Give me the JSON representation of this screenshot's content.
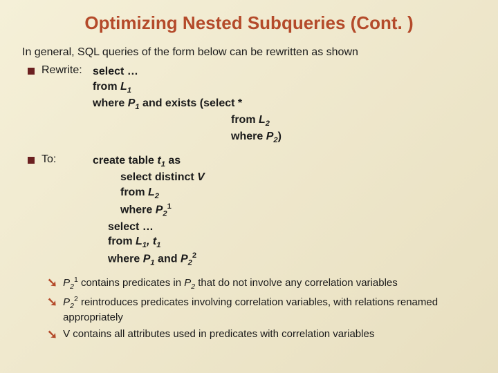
{
  "title": "Optimizing Nested Subqueries (Cont. )",
  "lead": "In general, SQL queries of the form below can be rewritten as shown",
  "rewrite_label": "Rewrite:",
  "to_label": "To:",
  "rewrite": {
    "l1": "select …",
    "l2a": "from ",
    "l2b": "L",
    "l2sub": "1",
    "l3a": "where ",
    "l3b": "P",
    "l3sub": "1",
    "l3c": " and exists (select *",
    "l4a": "from ",
    "l4b": "L",
    "l4sub": "2",
    "l5a": "where ",
    "l5b": "P",
    "l5sub": "2",
    "l5c": ")"
  },
  "to": {
    "l1a": "create table ",
    "l1b": "t",
    "l1sub": "1",
    "l1c": " as",
    "l2a": "select distinct ",
    "l2b": "V",
    "l3a": "from ",
    "l3b": "L",
    "l3sub": "2",
    "l4a": "where ",
    "l4b": "P",
    "l4sub": "2",
    "l4sup": "1",
    "l5": "select …",
    "l6a": "from ",
    "l6b": "L",
    "l6sub": "1",
    "l6c": ", ",
    "l6d": "t",
    "l6sub2": "1",
    "l7a": "where ",
    "l7b": "P",
    "l7sub": "1",
    "l7c": " and ",
    "l7d": "P",
    "l7sub2": "2",
    "l7sup": "2"
  },
  "notes": {
    "n1a": "P",
    "n1sub": "2",
    "n1sup": "1",
    "n1b": " contains predicates in ",
    "n1c": "P",
    "n1sub2": "2",
    "n1d": " that do not involve any correlation variables",
    "n2a": "P",
    "n2sub": "2",
    "n2sup": "2",
    "n2b": "  reintroduces predicates involving correlation variables, with relations renamed appropriately",
    "n3": "V contains all attributes used in predicates with correlation variables"
  }
}
